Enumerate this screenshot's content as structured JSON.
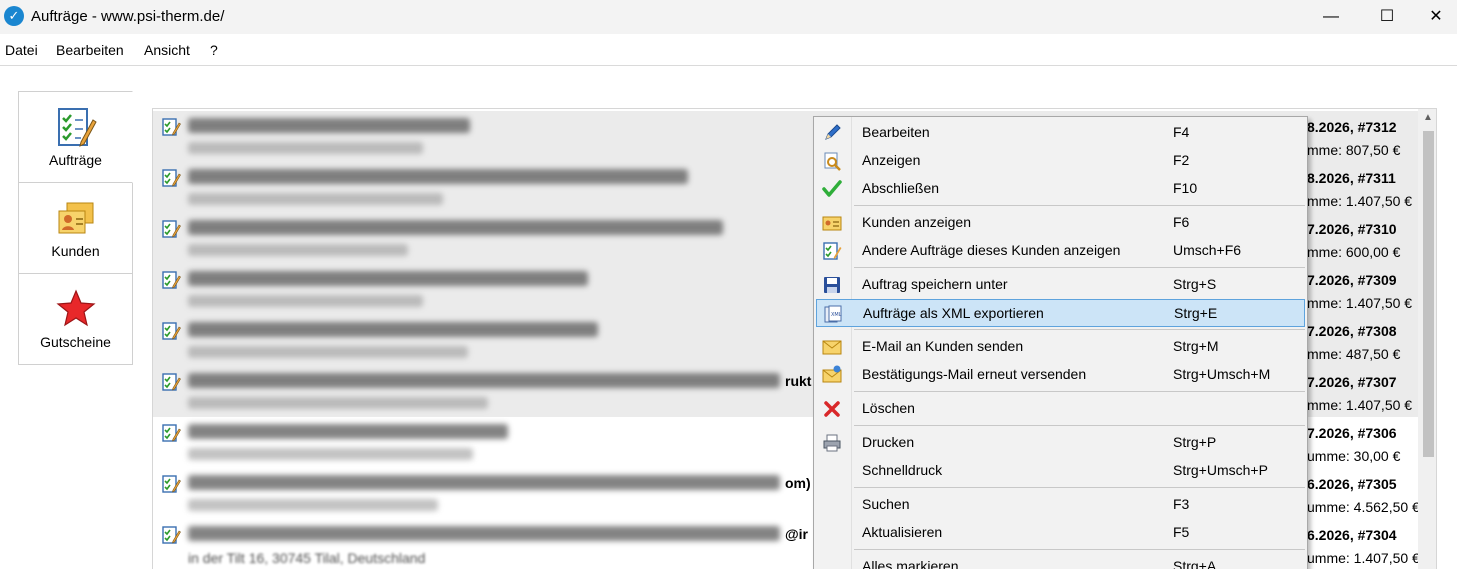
{
  "window": {
    "title": "Aufträge - www.psi-therm.de/",
    "minimize_glyph": "—",
    "maximize_glyph": "☐",
    "close_glyph": "✕"
  },
  "menubar": [
    "Datei",
    "Bearbeiten",
    "Ansicht",
    "?"
  ],
  "tabs": [
    {
      "label": "Aufträge",
      "icon": "orders-icon",
      "active": true
    },
    {
      "label": "Kunden",
      "icon": "customers-icon",
      "active": false
    },
    {
      "label": "Gutscheine",
      "icon": "star-icon",
      "active": false
    }
  ],
  "orders": [
    {
      "id": "8.2026, #7312",
      "sum": "mme:  807,50 €",
      "selected": true,
      "fragment": ""
    },
    {
      "id": "8.2026, #7311",
      "sum": "mme:  1.407,50 €",
      "selected": true,
      "fragment": ""
    },
    {
      "id": "7.2026, #7310",
      "sum": "mme:  600,00 €",
      "selected": true,
      "fragment": ""
    },
    {
      "id": "7.2026, #7309",
      "sum": "mme:  1.407,50 €",
      "selected": true,
      "fragment": ""
    },
    {
      "id": "7.2026, #7308",
      "sum": "mme:  487,50 €",
      "selected": true,
      "fragment": ""
    },
    {
      "id": "7.2026, #7307",
      "sum": "mme:  1.407,50 €",
      "selected": true,
      "fragment": "rukt"
    },
    {
      "id": "7.2026, #7306",
      "sum": "umme:  30,00 €",
      "selected": false,
      "fragment": ""
    },
    {
      "id": "6.2026, #7305",
      "sum": "umme:  4.562,50 €",
      "selected": false,
      "fragment": "om)"
    },
    {
      "id": "6.2026, #7304",
      "sum": "umme:  1.407,50 €",
      "selected": false,
      "fragment": "@ir",
      "line2": "in der Tilt 16, 30745 Tilal, Deutschland"
    }
  ],
  "context_menu": [
    {
      "label": "Bearbeiten",
      "key": "F4",
      "icon": "pencil-icon"
    },
    {
      "label": "Anzeigen",
      "key": "F2",
      "icon": "view-icon"
    },
    {
      "label": "Abschließen",
      "key": "F10",
      "icon": "checkmark-icon"
    },
    {
      "separator": true
    },
    {
      "label": "Kunden anzeigen",
      "key": "F6",
      "icon": "customer-card-icon"
    },
    {
      "label": "Andere Aufträge dieses Kunden anzeigen",
      "key": "Umsch+F6",
      "icon": "order-icon"
    },
    {
      "separator": true
    },
    {
      "label": "Auftrag speichern unter",
      "key": "Strg+S",
      "icon": "save-icon"
    },
    {
      "label": "Aufträge als XML exportieren",
      "key": "Strg+E",
      "icon": "xml-export-icon",
      "highlighted": true
    },
    {
      "separator": true
    },
    {
      "label": "E-Mail an Kunden senden",
      "key": "Strg+M",
      "icon": "mail-icon"
    },
    {
      "label": "Bestätigungs-Mail erneut versenden",
      "key": "Strg+Umsch+M",
      "icon": "mail-resend-icon"
    },
    {
      "separator": true
    },
    {
      "label": "Löschen",
      "key": "",
      "icon": "delete-icon"
    },
    {
      "separator": true
    },
    {
      "label": "Drucken",
      "key": "Strg+P",
      "icon": "printer-icon"
    },
    {
      "label": "Schnelldruck",
      "key": "Strg+Umsch+P",
      "icon": ""
    },
    {
      "separator": true
    },
    {
      "label": "Suchen",
      "key": "F3",
      "icon": ""
    },
    {
      "label": "Aktualisieren",
      "key": "F5",
      "icon": ""
    },
    {
      "separator": true
    },
    {
      "label": "Alles markieren",
      "key": "Strg+A",
      "icon": ""
    }
  ],
  "colors": {
    "highlight": "#cce4f7",
    "highlight_border": "#5ea3dd",
    "selection": "#ebebeb",
    "accent": "#1a86d0"
  }
}
